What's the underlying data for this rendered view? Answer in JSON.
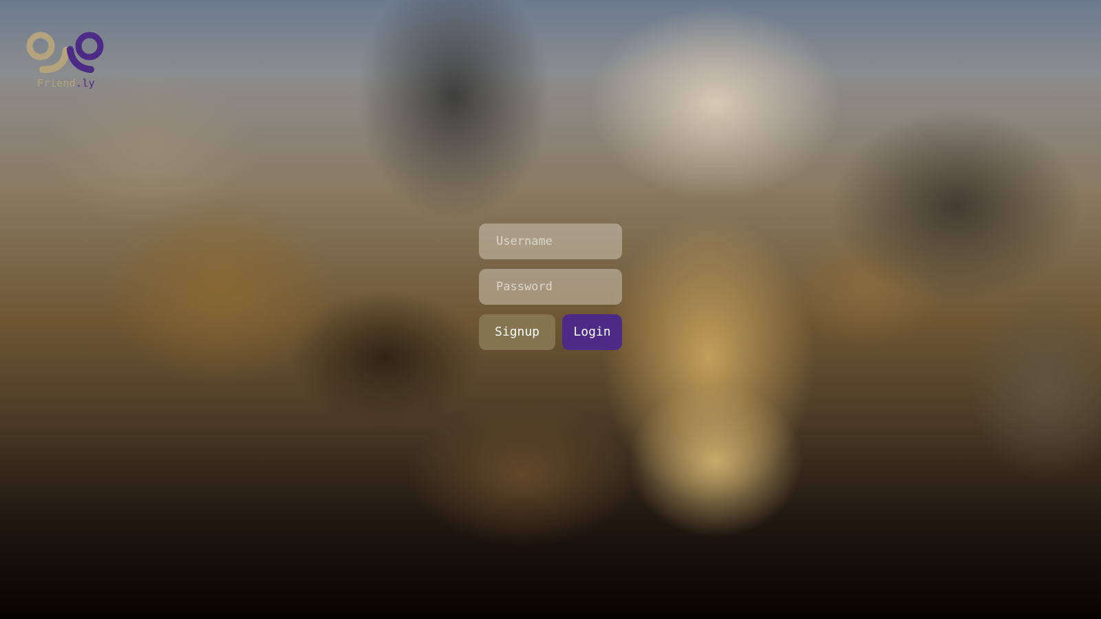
{
  "logo": {
    "text_part1": "Friend",
    "text_part2": ".ly",
    "accent_color": "#b4a37c",
    "brand_color": "#4d2a86"
  },
  "form": {
    "username_placeholder": "Username",
    "password_placeholder": "Password",
    "signup_label": "Signup",
    "login_label": "Login"
  }
}
